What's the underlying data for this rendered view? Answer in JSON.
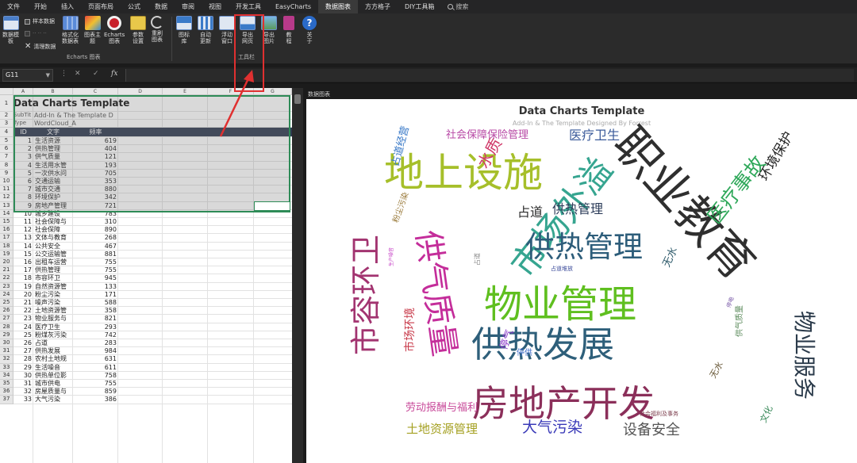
{
  "menu": {
    "items": [
      "文件",
      "开始",
      "插入",
      "页面布局",
      "公式",
      "数据",
      "审阅",
      "视图",
      "开发工具",
      "EasyCharts",
      "数据图表",
      "方方格子",
      "DIY工具箱"
    ],
    "active_index": 10,
    "search_label": "搜索"
  },
  "ribbon": {
    "btn_template": "数据模\n板",
    "sample_data": "样本数据",
    "clear_data": "清理数据",
    "btn_format": "格式化\n数据表",
    "btn_theme": "图表主\n题",
    "btn_echarts": "Echarts\n图表",
    "btn_params": "参数\n设置",
    "btn_redraw": "重刷\n图表",
    "group_echarts": "Echarts 图表",
    "btn_library": "图标\n库",
    "btn_autoupdate": "自动\n更新",
    "btn_float": "浮动\n窗口",
    "btn_export_web": "导出\n网页",
    "btn_export_img": "导出\n图片",
    "btn_tutorial": "教\n程",
    "btn_about": "关\n于",
    "group_tools": "工具栏"
  },
  "formula_bar": {
    "name_box": "G11",
    "formula": ""
  },
  "sheet": {
    "columns": [
      "A",
      "B",
      "C",
      "D",
      "E",
      "F",
      "G"
    ],
    "title": "Data Charts Template",
    "subtitle_label": "SubTit",
    "subtitle_value": "Add-In & The Template D",
    "type_label": "Type",
    "type_value": "WordCloud_A",
    "header": {
      "id": "ID",
      "text": "文字",
      "freq": "频率"
    },
    "rows": [
      [
        "1",
        "生活资源",
        "619"
      ],
      [
        "2",
        "供热管理",
        "404"
      ],
      [
        "3",
        "供气质量",
        "121"
      ],
      [
        "4",
        "生活用水管",
        "193"
      ],
      [
        "5",
        "一次供水问",
        "705"
      ],
      [
        "6",
        "交通运输",
        "353"
      ],
      [
        "7",
        "城市交通",
        "880"
      ],
      [
        "8",
        "环境保护",
        "342"
      ],
      [
        "9",
        "房地产管理",
        "721"
      ],
      [
        "10",
        "城乡建设",
        "783"
      ],
      [
        "11",
        "社会保障与",
        "310"
      ],
      [
        "12",
        "社会保障",
        "890"
      ],
      [
        "13",
        "文体与教育",
        "268"
      ],
      [
        "14",
        "公共安全",
        "467"
      ],
      [
        "15",
        "公交运输管",
        "881"
      ],
      [
        "16",
        "出租车运营",
        "755"
      ],
      [
        "17",
        "供热管理",
        "755"
      ],
      [
        "18",
        "市容环卫",
        "945"
      ],
      [
        "19",
        "自然资源管",
        "133"
      ],
      [
        "20",
        "粉尘污染",
        "171"
      ],
      [
        "21",
        "噪声污染",
        "588"
      ],
      [
        "22",
        "土地资源管",
        "358"
      ],
      [
        "23",
        "物业服务与",
        "821"
      ],
      [
        "24",
        "医疗卫生",
        "293"
      ],
      [
        "25",
        "粉煤灰污染",
        "742"
      ],
      [
        "26",
        "占道",
        "283"
      ],
      [
        "27",
        "供热发展",
        "984"
      ],
      [
        "28",
        "农村土地规",
        "631"
      ],
      [
        "29",
        "生活噪音",
        "611"
      ],
      [
        "30",
        "供热单位影",
        "758"
      ],
      [
        "31",
        "城市供电",
        "755"
      ],
      [
        "32",
        "房屋质量与",
        "859"
      ],
      [
        "33",
        "大气污染",
        "386"
      ]
    ]
  },
  "pane": {
    "title": "数据图表"
  },
  "chart_data": {
    "type": "wordcloud",
    "title": "Data Charts Template",
    "subtitle": "Add-In & The Template Designed By Forrest",
    "words": [
      {
        "text": "职业教育",
        "color": "#2f2f2f"
      },
      {
        "text": "市场外溢",
        "color": "#36a590"
      },
      {
        "text": "地上设施",
        "color": "#a6bf2a"
      },
      {
        "text": "物业管理",
        "color": "#5fbf1f"
      },
      {
        "text": "供热发展",
        "color": "#2e5f7a"
      },
      {
        "text": "房地产开发",
        "color": "#8b2f5a"
      },
      {
        "text": "供气质量",
        "color": "#c42d9a"
      },
      {
        "text": "市容环卫",
        "color": "#a23470"
      },
      {
        "text": "物业服务",
        "color": "#2a3a4a"
      },
      {
        "text": "供热管理",
        "color": "#2d5d7a"
      },
      {
        "text": "医疗事故",
        "color": "#2fa85a"
      },
      {
        "text": "环境保护",
        "color": "#222222"
      },
      {
        "text": "水质",
        "color": "#d03a6a"
      },
      {
        "text": "医疗卫生",
        "color": "#3a5a9a"
      },
      {
        "text": "社会保障保险管理",
        "color": "#b84aa6"
      },
      {
        "text": "占道经营",
        "color": "#3a7ac8"
      },
      {
        "text": "占道",
        "color": "#2a2a2a"
      },
      {
        "text": "供热管理",
        "color": "#2d3d5a"
      },
      {
        "text": "无水",
        "color": "#2e5a6a"
      },
      {
        "text": "市场环境",
        "color": "#c83a4a"
      },
      {
        "text": "劳动报酬与福利",
        "color": "#c84a9a"
      },
      {
        "text": "土地资源管理",
        "color": "#a4a020"
      },
      {
        "text": "大气污染",
        "color": "#3a3ab8"
      },
      {
        "text": "设备安全",
        "color": "#555555"
      },
      {
        "text": "停气",
        "color": "#8a3ac8"
      },
      {
        "text": "停供",
        "color": "#3a6ac8"
      },
      {
        "text": "粉尘污染",
        "color": "#9a7a3a"
      },
      {
        "text": "文化",
        "color": "#3a8a5a"
      },
      {
        "text": "供气质量",
        "color": "#5a8a5a"
      },
      {
        "text": "无水",
        "color": "#6a5a3a"
      },
      {
        "text": "占道堆放",
        "color": "#3a4a9a"
      },
      {
        "text": "社会福利及事务",
        "color": "#7a3a4a"
      },
      {
        "text": "占道",
        "color": "#888888"
      },
      {
        "text": "生产噪音",
        "color": "#c84ac8"
      },
      {
        "text": "停电",
        "color": "#7a5aa8"
      }
    ]
  }
}
